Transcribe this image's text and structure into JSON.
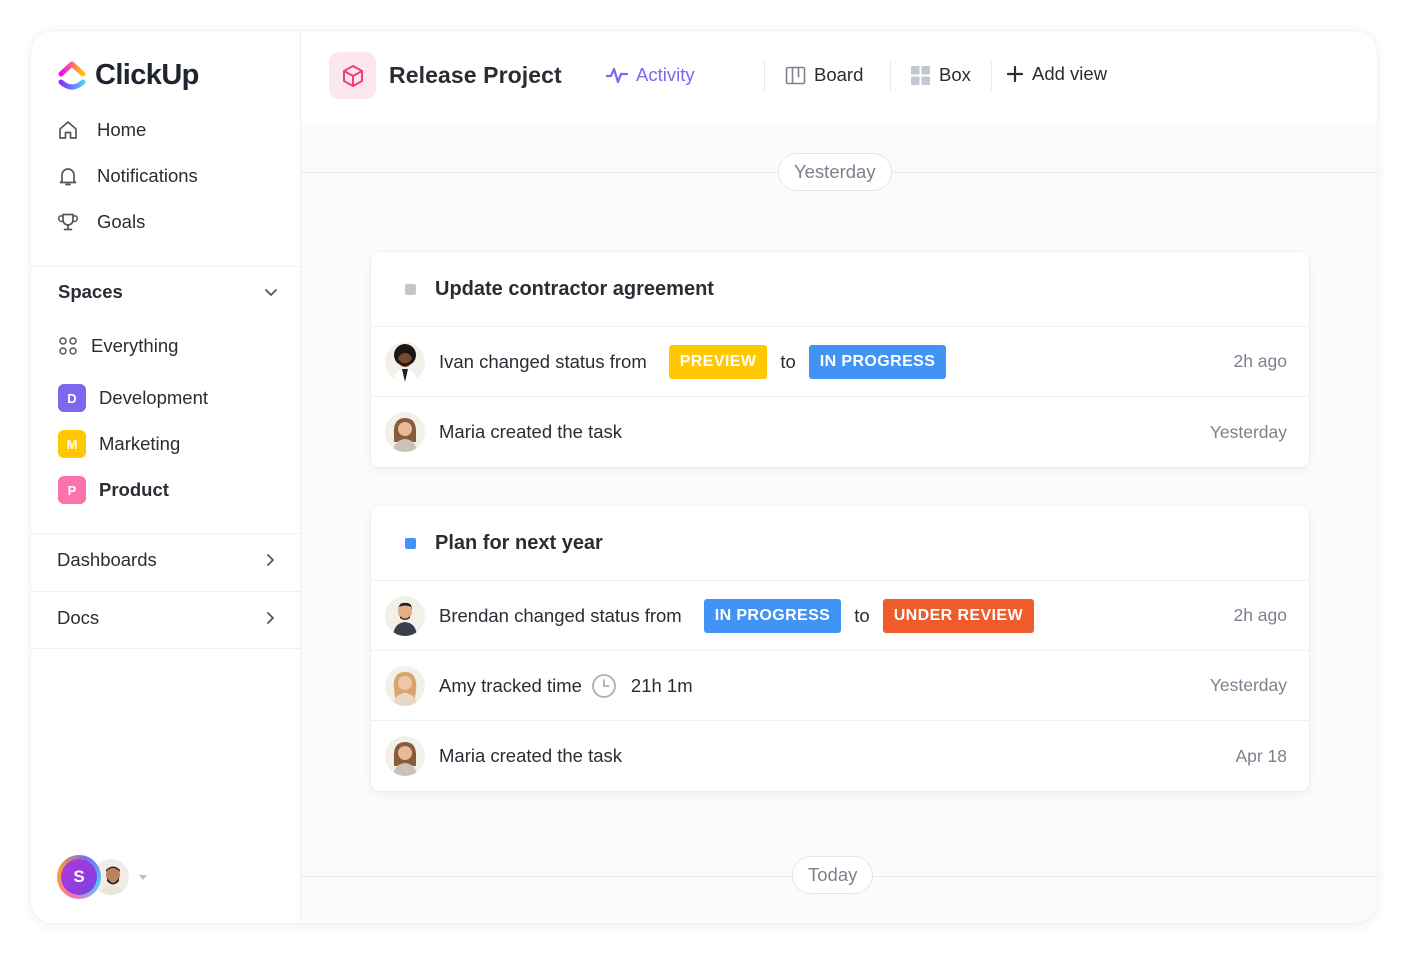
{
  "brand": {
    "name": "ClickUp"
  },
  "sidebar": {
    "nav": [
      {
        "label": "Home",
        "icon": "home-icon"
      },
      {
        "label": "Notifications",
        "icon": "bell-icon"
      },
      {
        "label": "Goals",
        "icon": "trophy-icon"
      }
    ],
    "spaces_title": "Spaces",
    "everything_label": "Everything",
    "spaces": [
      {
        "letter": "D",
        "label": "Development",
        "color": "#7b68ee"
      },
      {
        "letter": "M",
        "label": "Marketing",
        "color": "#ffc800"
      },
      {
        "letter": "P",
        "label": "Product",
        "color": "#fd71af"
      }
    ],
    "sections": [
      {
        "label": "Dashboards"
      },
      {
        "label": "Docs"
      }
    ],
    "user_initial": "S"
  },
  "header": {
    "project_title": "Release Project",
    "views": [
      {
        "label": "Activity",
        "icon": "activity-icon",
        "active": true
      },
      {
        "label": "Board",
        "icon": "board-icon",
        "active": false
      },
      {
        "label": "Box",
        "icon": "box-grid-icon",
        "active": false
      },
      {
        "label": "Add view",
        "icon": "plus-icon",
        "active": false
      }
    ],
    "accent": "#7b68ee"
  },
  "activity": {
    "days": [
      "Yesterday",
      "Today"
    ],
    "cards": [
      {
        "title": "Update contractor agreement",
        "marker_color": "#c4c6cc",
        "rows": [
          {
            "text": "Ivan changed status from",
            "from": "PREVIEW",
            "from_color": "#ffc800",
            "connector": "to",
            "to": "IN PROGRESS",
            "to_color": "#4194f6",
            "time": "2h ago"
          },
          {
            "text": "Maria created the task",
            "time": "Yesterday"
          }
        ]
      },
      {
        "title": "Plan for next year",
        "marker_color": "#4194f6",
        "rows": [
          {
            "text": "Brendan changed status from",
            "from": "IN PROGRESS",
            "from_color": "#4194f6",
            "connector": "to",
            "to": "UNDER REVIEW",
            "to_color": "#f05b2b",
            "time": "2h ago"
          },
          {
            "text": "Amy tracked time",
            "duration": "21h 1m",
            "time": "Yesterday"
          },
          {
            "text": "Maria created the task",
            "time": "Apr 18"
          }
        ]
      }
    ]
  }
}
